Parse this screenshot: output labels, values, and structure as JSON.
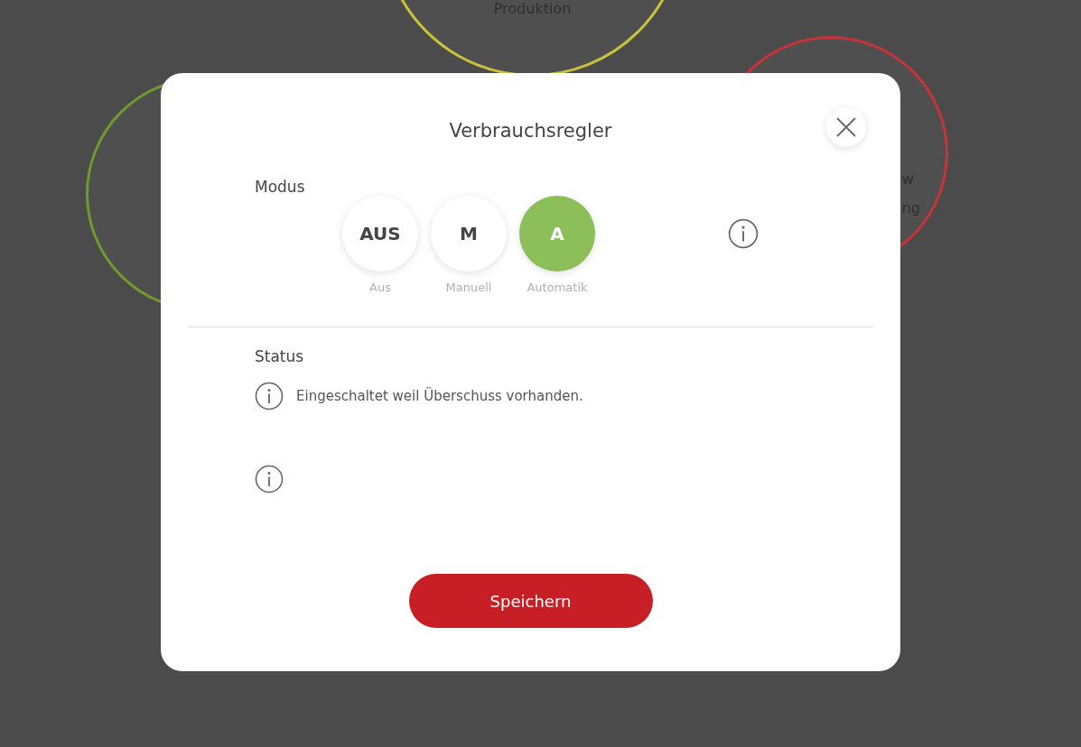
{
  "background": {
    "tiles": [
      {
        "label": "Produktion",
        "color": "#c9c23a"
      },
      {
        "color": "#6f9a2e"
      },
      {
        "label": "w\nng",
        "color": "#c8323a"
      }
    ]
  },
  "dialog": {
    "title": "Verbrauchsregler",
    "mode": {
      "label": "Modus",
      "options": [
        {
          "short": "AUS",
          "label": "Aus",
          "selected": false
        },
        {
          "short": "M",
          "label": "Manuell",
          "selected": false
        },
        {
          "short": "A",
          "label": "Automatik",
          "selected": true
        }
      ]
    },
    "status": {
      "label": "Status",
      "messages": [
        {
          "kind": "text",
          "text": "Eingeschaltet weil Überschuss vorhanden."
        },
        {
          "kind": "blank"
        }
      ]
    },
    "save_button": "Speichern"
  }
}
